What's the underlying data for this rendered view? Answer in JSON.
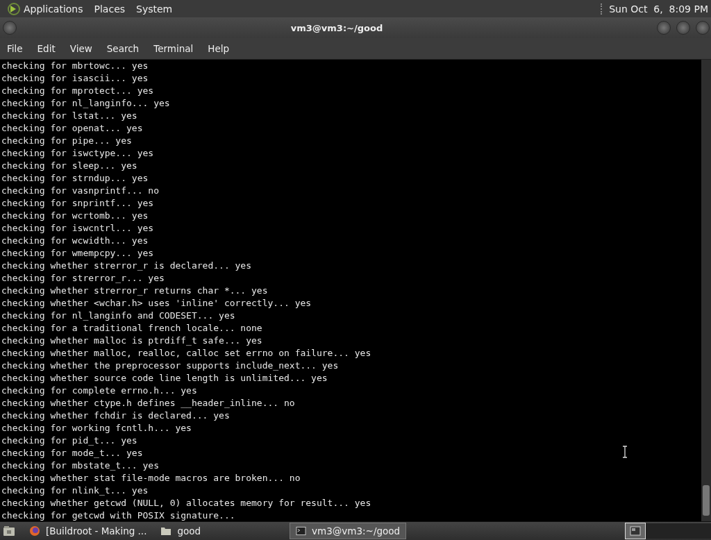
{
  "top_panel": {
    "menus": [
      "Applications",
      "Places",
      "System"
    ],
    "clock": "Sun Oct  6,  8:09 PM"
  },
  "window": {
    "title": "vm3@vm3:~/good",
    "menu": [
      "File",
      "Edit",
      "View",
      "Search",
      "Terminal",
      "Help"
    ]
  },
  "terminal": {
    "lines": [
      "checking for mbrtowc... yes",
      "checking for isascii... yes",
      "checking for mprotect... yes",
      "checking for nl_langinfo... yes",
      "checking for lstat... yes",
      "checking for openat... yes",
      "checking for pipe... yes",
      "checking for iswctype... yes",
      "checking for sleep... yes",
      "checking for strndup... yes",
      "checking for vasnprintf... no",
      "checking for snprintf... yes",
      "checking for wcrtomb... yes",
      "checking for iswcntrl... yes",
      "checking for wcwidth... yes",
      "checking for wmempcpy... yes",
      "checking whether strerror_r is declared... yes",
      "checking for strerror_r... yes",
      "checking whether strerror_r returns char *... yes",
      "checking whether <wchar.h> uses 'inline' correctly... yes",
      "checking for nl_langinfo and CODESET... yes",
      "checking for a traditional french locale... none",
      "checking whether malloc is ptrdiff_t safe... yes",
      "checking whether malloc, realloc, calloc set errno on failure... yes",
      "checking whether the preprocessor supports include_next... yes",
      "checking whether source code line length is unlimited... yes",
      "checking for complete errno.h... yes",
      "checking whether ctype.h defines __header_inline... no",
      "checking whether fchdir is declared... yes",
      "checking for working fcntl.h... yes",
      "checking for pid_t... yes",
      "checking for mode_t... yes",
      "checking for mbstate_t... yes",
      "checking whether stat file-mode macros are broken... no",
      "checking for nlink_t... yes",
      "checking whether getcwd (NULL, 0) allocates memory for result... yes",
      "checking for getcwd with POSIX signature..."
    ]
  },
  "taskbar": {
    "items": [
      {
        "kind": "browser",
        "label": "[Buildroot - Making ...",
        "selected": false
      },
      {
        "kind": "folder",
        "label": "good",
        "selected": false
      },
      {
        "kind": "terminal",
        "label": "vm3@vm3:~/good",
        "selected": true
      }
    ],
    "workspaces": [
      {
        "selected": true
      }
    ]
  }
}
